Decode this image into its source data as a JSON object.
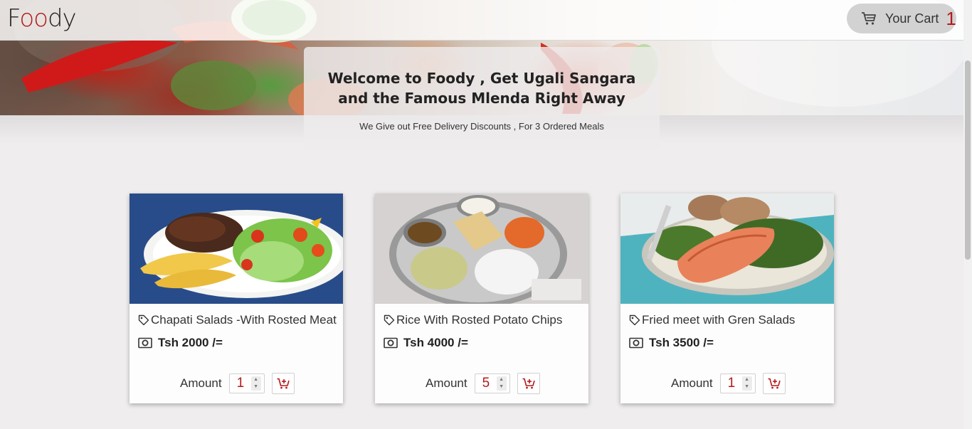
{
  "header": {
    "logo": {
      "f": "F",
      "oo": "oo",
      "dy": "dy"
    },
    "cart": {
      "label": "Your Cart",
      "count": "1",
      "icon": "cart-icon"
    }
  },
  "hero": {
    "title": "Welcome to Foody , Get Ugali Sangara and the Famous Mlenda Right Away",
    "subtitle": "We Give out Free Delivery Discounts , For 3 Ordered Meals"
  },
  "products": [
    {
      "name": "Chapati Salads -With Rosted Meat",
      "price": "Tsh 2000 /=",
      "amount_label": "Amount",
      "amount": "1"
    },
    {
      "name": "Rice With Rosted Potato Chips",
      "price": "Tsh 4000 /=",
      "amount_label": "Amount",
      "amount": "5"
    },
    {
      "name": "Fried meet with Gren Salads",
      "price": "Tsh 3500 /=",
      "amount_label": "Amount",
      "amount": "1"
    }
  ],
  "colors": {
    "accent": "#b41a1a",
    "background": "#efedee",
    "cart_bg": "#d2d2d2"
  }
}
